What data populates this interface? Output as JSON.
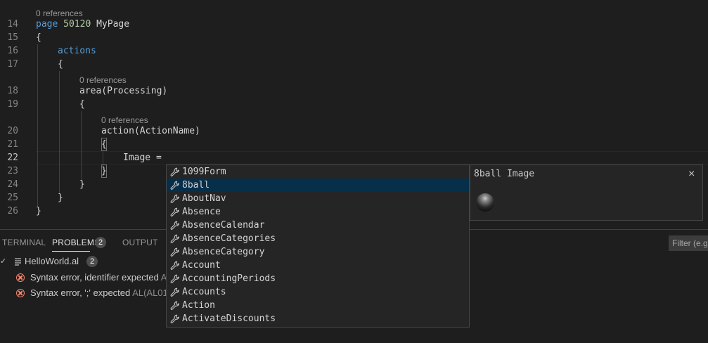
{
  "editor": {
    "top_line_number": "",
    "lines": [
      {
        "num": "14",
        "lens": "0 references",
        "keyword": "page",
        "number": "50120",
        "name": "MyPage"
      },
      {
        "num": "15",
        "text": "{"
      },
      {
        "num": "16",
        "keyword": "actions"
      },
      {
        "num": "17",
        "text": "{"
      },
      {
        "num": "18",
        "lens": "0 references",
        "text": "area(Processing)"
      },
      {
        "num": "19",
        "text": "{"
      },
      {
        "num": "20",
        "lens": "0 references",
        "text": "action(ActionName)"
      },
      {
        "num": "21",
        "text": "{"
      },
      {
        "num": "22",
        "text": "Image ="
      },
      {
        "num": "23",
        "text": "}"
      },
      {
        "num": "24",
        "text": "}"
      },
      {
        "num": "25",
        "text": "}"
      },
      {
        "num": "26",
        "text": "}"
      }
    ]
  },
  "suggest": {
    "items": [
      {
        "label": "1099Form",
        "icon": "wrench-icon"
      },
      {
        "label": "8ball",
        "icon": "wrench-icon",
        "selected": true
      },
      {
        "label": "AboutNav",
        "icon": "wrench-icon"
      },
      {
        "label": "Absence",
        "icon": "wrench-icon"
      },
      {
        "label": "AbsenceCalendar",
        "icon": "wrench-icon"
      },
      {
        "label": "AbsenceCategories",
        "icon": "wrench-icon"
      },
      {
        "label": "AbsenceCategory",
        "icon": "wrench-icon"
      },
      {
        "label": "Account",
        "icon": "wrench-icon"
      },
      {
        "label": "AccountingPeriods",
        "icon": "wrench-icon"
      },
      {
        "label": "Accounts",
        "icon": "wrench-icon"
      },
      {
        "label": "Action",
        "icon": "wrench-icon"
      },
      {
        "label": "ActivateDiscounts",
        "icon": "wrench-icon"
      }
    ],
    "details": {
      "title": "8ball Image",
      "close": "×"
    }
  },
  "panel": {
    "tabs": {
      "terminal": "TERMINAL",
      "problems": "PROBLEMS",
      "problems_count": "2",
      "output": "OUTPUT"
    },
    "filter_placeholder": "Filter (e.g.",
    "file": {
      "chevron": "✓",
      "name": "HelloWorld.al",
      "count": "2"
    },
    "problems": [
      {
        "message": "Syntax error, identifier expected",
        "source": "A"
      },
      {
        "message": "Syntax error, ';' expected",
        "source": "AL(AL01"
      }
    ]
  },
  "colors": {
    "background": "#1e1e1e",
    "keyword": "#569cd6",
    "number": "#b5cea8",
    "selection": "#062f4a",
    "error": "#f48771"
  }
}
